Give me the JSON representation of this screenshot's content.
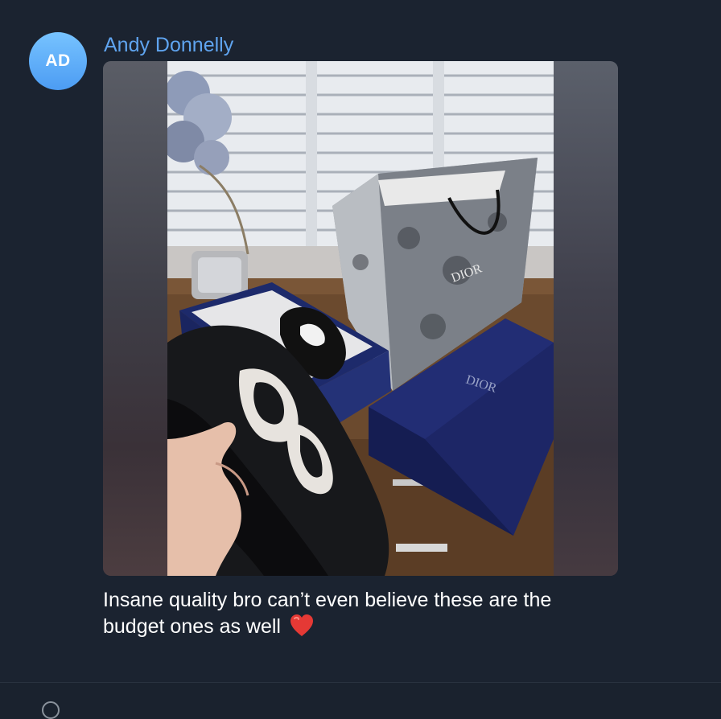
{
  "message": {
    "avatar_initials": "AD",
    "sender_name": "Andy Donnelly",
    "caption": "Insane quality bro can’t even believe these are the budget ones as well",
    "caption_emoji": "heart-emoji",
    "photo": {
      "bag_brand_text": "DIOR",
      "box_brand_text": "DIOR"
    }
  },
  "colors": {
    "background": "#1b2330",
    "sender_name": "#5fa4ef",
    "avatar": "#5aaaf7",
    "caption_text": "#ffffff"
  }
}
